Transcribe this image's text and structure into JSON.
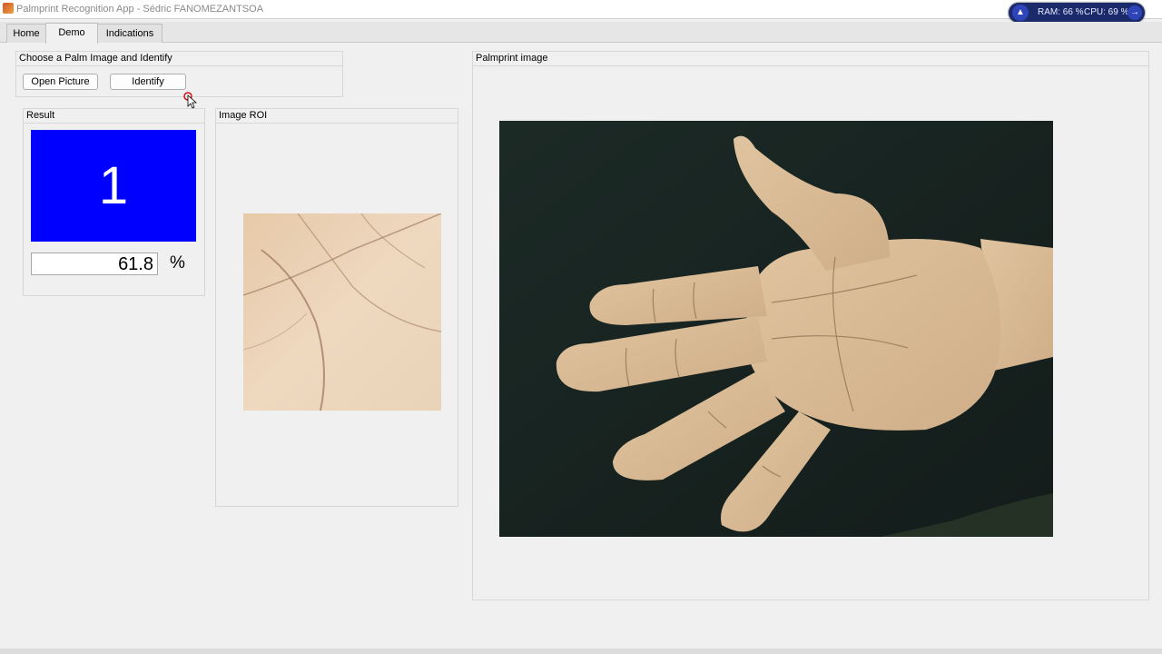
{
  "window": {
    "title": "Palmprint Recognition App - Sédric FANOMEZANTSOA"
  },
  "sysmon": {
    "ram": "RAM: 66 %",
    "cpu": "CPU: 69 %"
  },
  "tabs": [
    {
      "label": "Home",
      "active": false
    },
    {
      "label": "Demo",
      "active": true
    },
    {
      "label": "Indications",
      "active": false
    }
  ],
  "choose_panel": {
    "title": "Choose a Palm Image and Identify",
    "open_label": "Open Picture",
    "identify_label": "Identify"
  },
  "result_panel": {
    "title": "Result",
    "id_value": "1",
    "score_value": "61.8",
    "unit": "%",
    "box_color": "#0000ff"
  },
  "roi_panel": {
    "title": "Image ROI"
  },
  "palm_panel": {
    "title": "Palmprint image"
  }
}
